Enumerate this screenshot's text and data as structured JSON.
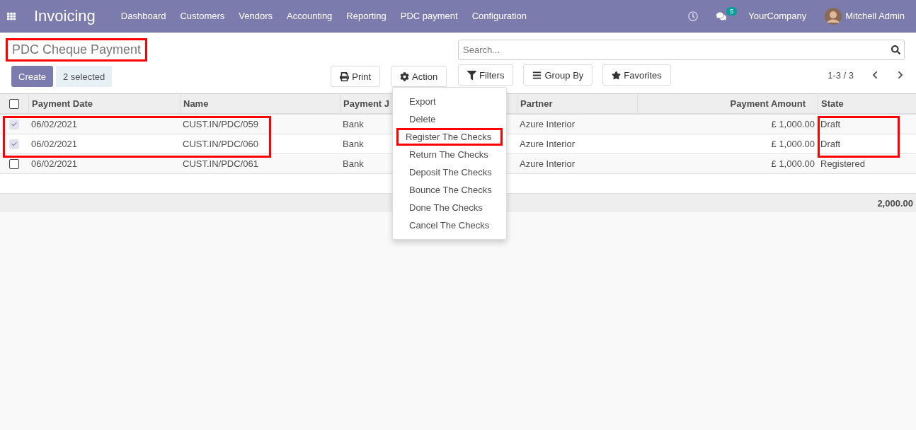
{
  "navbar": {
    "app_name": "Invoicing",
    "menu": [
      "Dashboard",
      "Customers",
      "Vendors",
      "Accounting",
      "Reporting",
      "PDC payment",
      "Configuration"
    ],
    "messages_count": "5",
    "company": "YourCompany",
    "user": "Mitchell Admin"
  },
  "control_panel": {
    "title": "PDC Cheque Payment",
    "title_highlighted": true,
    "create": "Create",
    "selection": "2 selected",
    "print": "Print",
    "action": "Action",
    "filters": "Filters",
    "group_by": "Group By",
    "favorites": "Favorites",
    "search": {
      "placeholder": "Search..."
    },
    "pager": "1-3 / 3"
  },
  "action_menu": [
    {
      "label": "Export",
      "highlighted": false
    },
    {
      "label": "Delete",
      "highlighted": false
    },
    {
      "label": "Register The Checks",
      "highlighted": true
    },
    {
      "label": "Return The Checks",
      "highlighted": false
    },
    {
      "label": "Deposit The Checks",
      "highlighted": false
    },
    {
      "label": "Bounce The Checks",
      "highlighted": false
    },
    {
      "label": "Done The Checks",
      "highlighted": false
    },
    {
      "label": "Cancel The Checks",
      "highlighted": false
    }
  ],
  "table": {
    "all_checked": false,
    "columns": [
      "Payment Date",
      "Name",
      "Payment J",
      "Partner",
      "Payment Amount",
      "State"
    ],
    "rows": [
      {
        "checked": true,
        "highlighted": true,
        "cells": [
          "06/02/2021",
          "CUST.IN/PDC/059",
          "Bank",
          "Azure Interior",
          "£ 1,000.00",
          "Draft"
        ]
      },
      {
        "checked": true,
        "highlighted": true,
        "cells": [
          "06/02/2021",
          "CUST.IN/PDC/060",
          "Bank",
          "Azure Interior",
          "£ 1,000.00",
          "Draft"
        ]
      },
      {
        "checked": false,
        "highlighted": false,
        "cells": [
          "06/02/2021",
          "CUST.IN/PDC/061",
          "Bank",
          "Azure Interior",
          "£ 1,000.00",
          "Registered"
        ]
      }
    ],
    "total": "2,000.00"
  }
}
